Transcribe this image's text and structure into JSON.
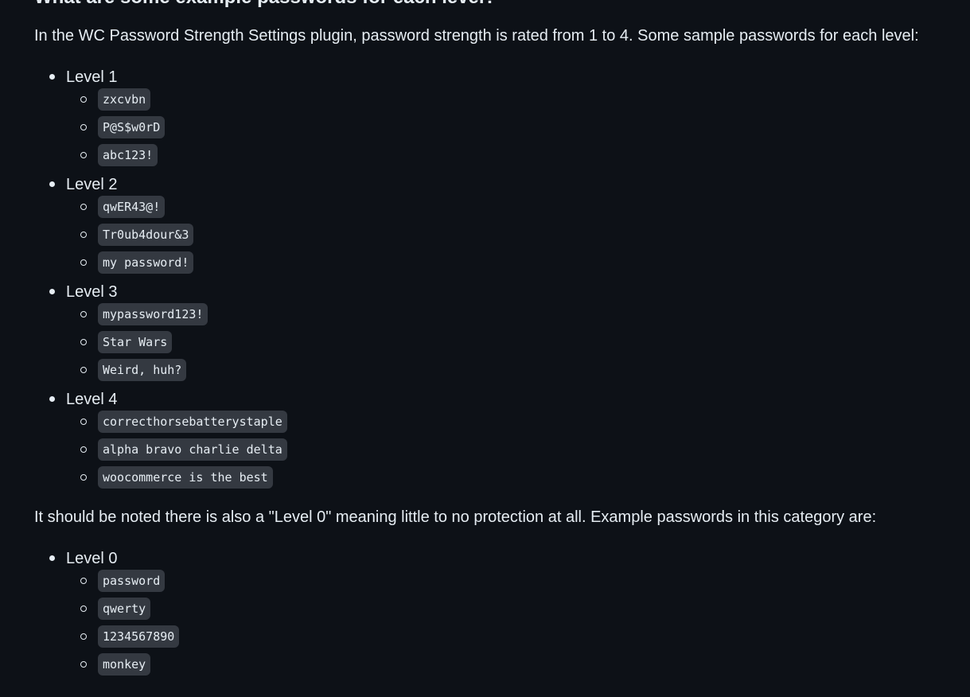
{
  "heading": "What are some example passwords for each level?",
  "intro": "In the WC Password Strength Settings plugin, password strength is rated from 1 to 4. Some sample passwords for each level:",
  "levels": [
    {
      "label": "Level 1",
      "passwords": [
        "zxcvbn",
        "P@S$w0rD",
        "abc123!"
      ]
    },
    {
      "label": "Level 2",
      "passwords": [
        "qwER43@!",
        "Tr0ub4dour&3",
        "my password!"
      ]
    },
    {
      "label": "Level 3",
      "passwords": [
        "mypassword123!",
        "Star Wars",
        "Weird, huh?"
      ]
    },
    {
      "label": "Level 4",
      "passwords": [
        "correcthorsebatterystaple",
        "alpha bravo charlie delta",
        "woocommerce is the best"
      ]
    }
  ],
  "note": "It should be noted there is also a \"Level 0\" meaning little to no protection at all. Example passwords in this category are:",
  "level0": {
    "label": "Level 0",
    "passwords": [
      "password",
      "qwerty",
      "1234567890",
      "monkey"
    ]
  }
}
